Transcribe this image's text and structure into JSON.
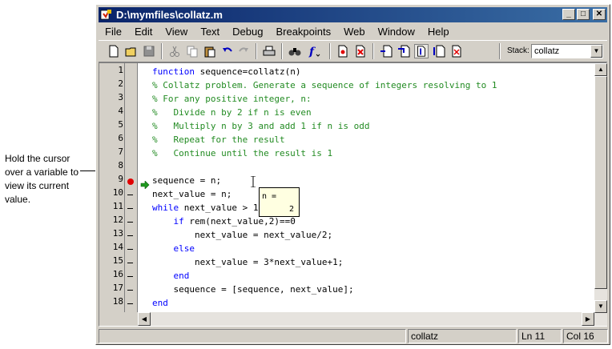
{
  "annotation": {
    "text": "Hold the cursor over a variable to view its current value."
  },
  "window": {
    "title": "D:\\mymfiles\\collatz.m",
    "controls": {
      "minimize": "_",
      "maximize": "□",
      "close": "✕"
    }
  },
  "menu": [
    "File",
    "Edit",
    "View",
    "Text",
    "Debug",
    "Breakpoints",
    "Web",
    "Window",
    "Help"
  ],
  "toolbar": {
    "stack_label": "Stack:",
    "stack_value": "collatz"
  },
  "editor": {
    "line_numbers": [
      "1",
      "2",
      "3",
      "4",
      "5",
      "6",
      "7",
      "8",
      "9",
      "10",
      "11",
      "12",
      "13",
      "14",
      "15",
      "16",
      "17",
      "18"
    ],
    "code": {
      "l1_kw": "function",
      "l1_rest": " sequence=collatz(n)",
      "l2": "% Collatz problem. Generate a sequence of integers resolving to 1",
      "l3": "% For any positive integer, n:",
      "l4": "%   Divide n by 2 if n is even",
      "l5": "%   Multiply n by 3 and add 1 if n is odd",
      "l6": "%   Repeat for the result",
      "l7": "%   Continue until the result is 1",
      "l9": "sequence = n;",
      "l10": "next_value = n;",
      "l11_kw": "while",
      "l11_rest": " next_value > 1",
      "l12_kw": "    if",
      "l12_rest": " rem(next_value,2)==0",
      "l13": "        next_value = next_value/2;",
      "l14_kw": "    else",
      "l15": "        next_value = 3*next_value+1;",
      "l16_kw": "    end",
      "l17": "    sequence = [sequence, next_value];",
      "l18_kw": "end"
    },
    "tooltip": {
      "name": "n =",
      "value": "2"
    }
  },
  "status": {
    "function": "collatz",
    "line": "Ln 11",
    "col": "Col 16"
  },
  "colors": {
    "keyword": "#0000ff",
    "comment": "#228b22",
    "breakpoint": "#e00000",
    "exec_arrow": "#1f9a1f",
    "tooltip_bg": "#ffffe1"
  }
}
